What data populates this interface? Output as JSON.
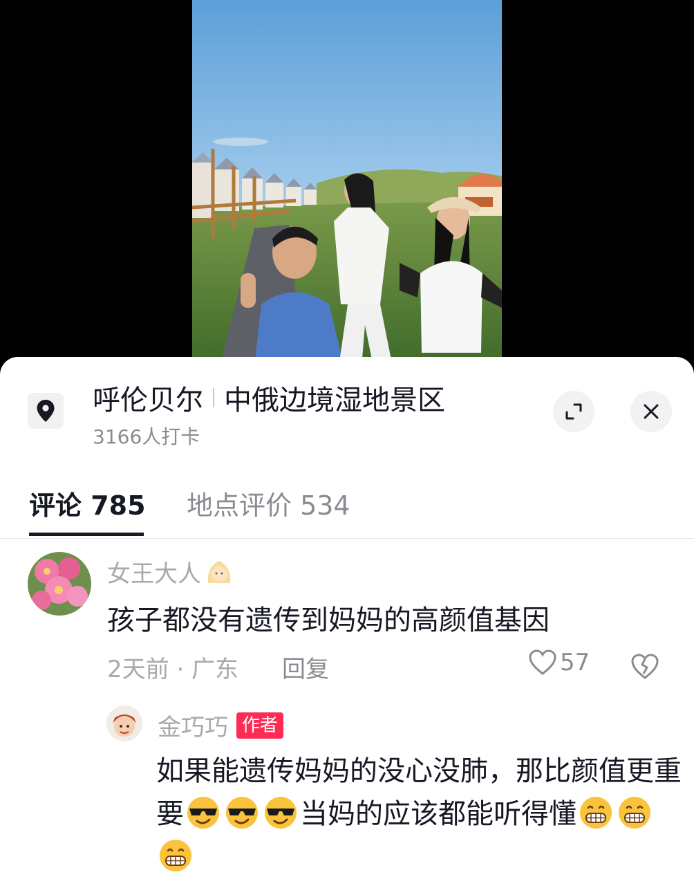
{
  "location": {
    "city": "呼伦贝尔",
    "place": "中俄边境湿地景区",
    "checkins": "3166人打卡"
  },
  "icons": {
    "location": "location-pin-icon",
    "expand": "expand-icon",
    "close": "close-icon",
    "like": "heart-outline-icon",
    "dislike": "broken-heart-icon",
    "emoji_sunglasses": "sunglasses-face-emoji",
    "emoji_grin": "grinning-face-emoji"
  },
  "tabs": [
    {
      "label": "评论 785",
      "active": true
    },
    {
      "label": "地点评价 534",
      "active": false
    }
  ],
  "comments": [
    {
      "username": "女王大人",
      "text": "孩子都没有遗传到妈妈的高颜值基因",
      "meta": "2天前 · 广东",
      "reply_label": "回复",
      "likes": "57"
    }
  ],
  "replies": [
    {
      "username": "金巧巧",
      "badge": "作者",
      "text_part1": "如果能遗传妈妈的没心没肺，那比颜值更重要",
      "text_part2": "当妈的应该都能听得懂"
    }
  ],
  "colors": {
    "accent": "#fe2c55",
    "text_primary": "#161823",
    "text_secondary": "#8a8b91"
  }
}
